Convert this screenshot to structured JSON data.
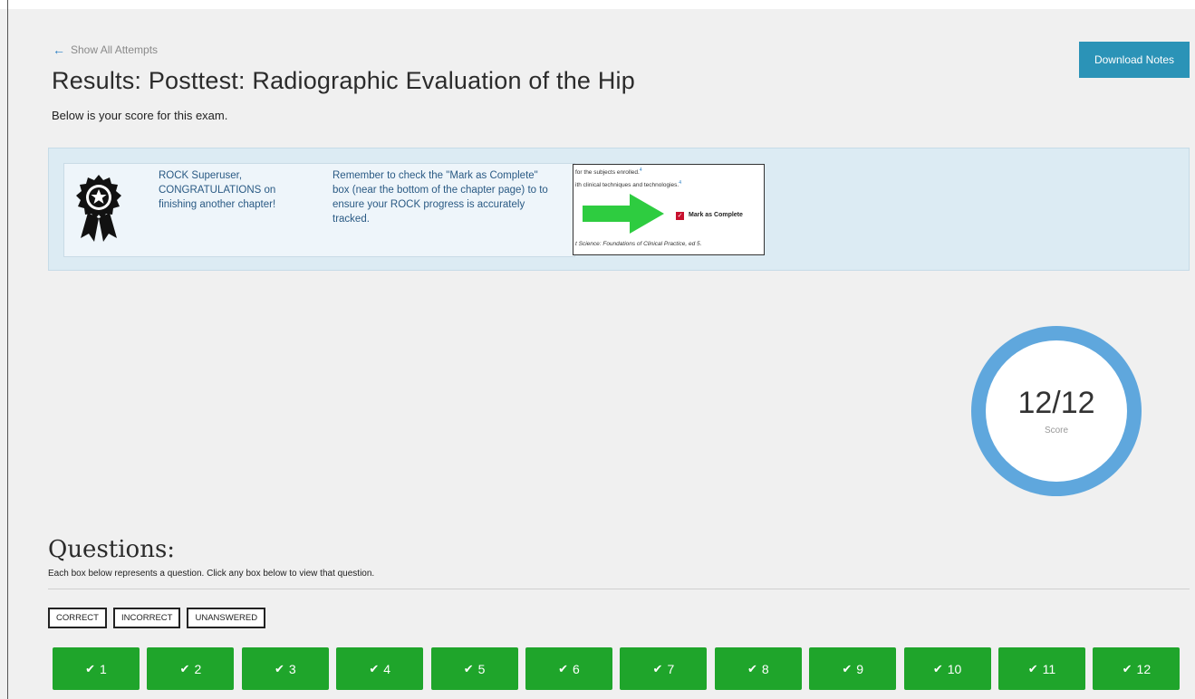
{
  "header": {
    "back_link": "Show All Attempts",
    "title": "Results: Posttest: Radiographic Evaluation of the Hip",
    "subtitle": "Below is your score for this exam.",
    "download_button": "Download Notes"
  },
  "banner": {
    "congrats": "ROCK Superuser, CONGRATULATIONS on finishing another chapter!",
    "reminder": "Remember to check the \"Mark as Complete\" box (near the bottom of the chapter page) to to ensure your ROCK progress is accurately tracked.",
    "snippet": {
      "line1": "for the subjects enrolled.",
      "line1_sup": "4",
      "line2": "ith clinical techniques and technologies.",
      "line2_sup": "4",
      "checkbox_label": "Mark as Complete",
      "footer": "t Science: Foundations of Clinical Practice, ed 5."
    }
  },
  "score": {
    "value": "12/12",
    "label": "Score",
    "ring_color": "#5fa7dd"
  },
  "questions": {
    "heading": "Questions:",
    "help": "Each box below represents a question. Click any box below to view that question.",
    "filters": [
      "CORRECT",
      "INCORRECT",
      "UNANSWERED"
    ],
    "items": [
      "1",
      "2",
      "3",
      "4",
      "5",
      "6",
      "7",
      "8",
      "9",
      "10",
      "11",
      "12"
    ],
    "correct_color": "#1fa52b"
  }
}
